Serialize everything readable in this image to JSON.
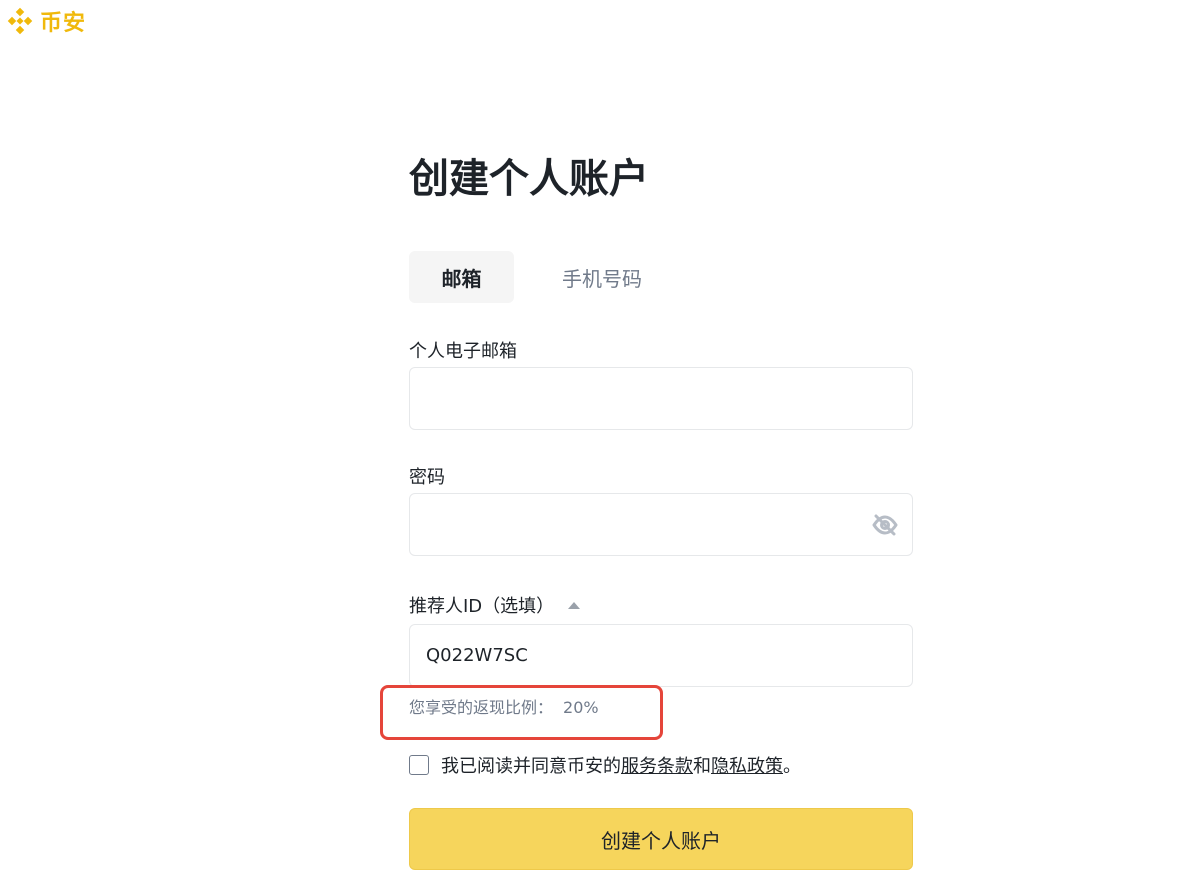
{
  "brand": {
    "name": "币安",
    "logo_icon": "binance-diamond-icon",
    "color": "#f0b90b"
  },
  "title": "创建个人账户",
  "tabs": [
    {
      "label": "邮箱",
      "active": true
    },
    {
      "label": "手机号码",
      "active": false
    }
  ],
  "email": {
    "label": "个人电子邮箱",
    "value": "",
    "placeholder": ""
  },
  "password": {
    "label": "密码",
    "value": "",
    "placeholder": "",
    "toggle_icon": "eye-off-icon"
  },
  "referral": {
    "label": "推荐人ID（选填）",
    "toggle_icon": "caret-up-icon",
    "value": "Q022W7SC"
  },
  "rebate": {
    "label": "您享受的返现比例：",
    "value": "20%"
  },
  "agreement": {
    "checked": false,
    "prefix": "我已阅读并同意币安的",
    "terms_link": "服务条款",
    "conjunction": "和",
    "privacy_link": "隐私政策",
    "suffix": "。"
  },
  "submit_label": "创建个人账户",
  "colors": {
    "accent": "#f6d55c",
    "highlight": "#e5453a",
    "muted": "#707a8a"
  }
}
